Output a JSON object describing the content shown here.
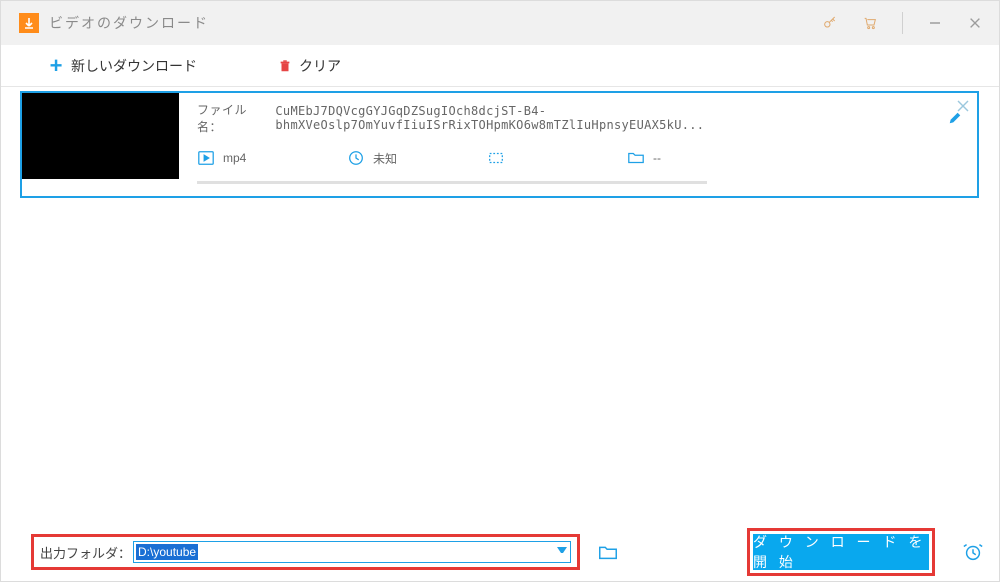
{
  "titlebar": {
    "title": "ビデオのダウンロード"
  },
  "toolbar": {
    "new_label": "新しいダウンロード",
    "clear_label": "クリア"
  },
  "item": {
    "filename_label": "ファイル名：",
    "filename": "CuMEbJ7DQVcgGYJGqDZSugIOch8dcjST-B4-bhmXVeOslp7OmYuvfIiuISrRixTOHpmKO6w8mTZlIuHpnsyEUAX5kU...",
    "format": "mp4",
    "duration": "未知",
    "dimension": "",
    "folder": "--"
  },
  "bottom": {
    "output_label": "出力フォルダ：",
    "path": "D:\\youtube",
    "start_label": "ダ ウ ン ロ ー ド を 開 始"
  }
}
